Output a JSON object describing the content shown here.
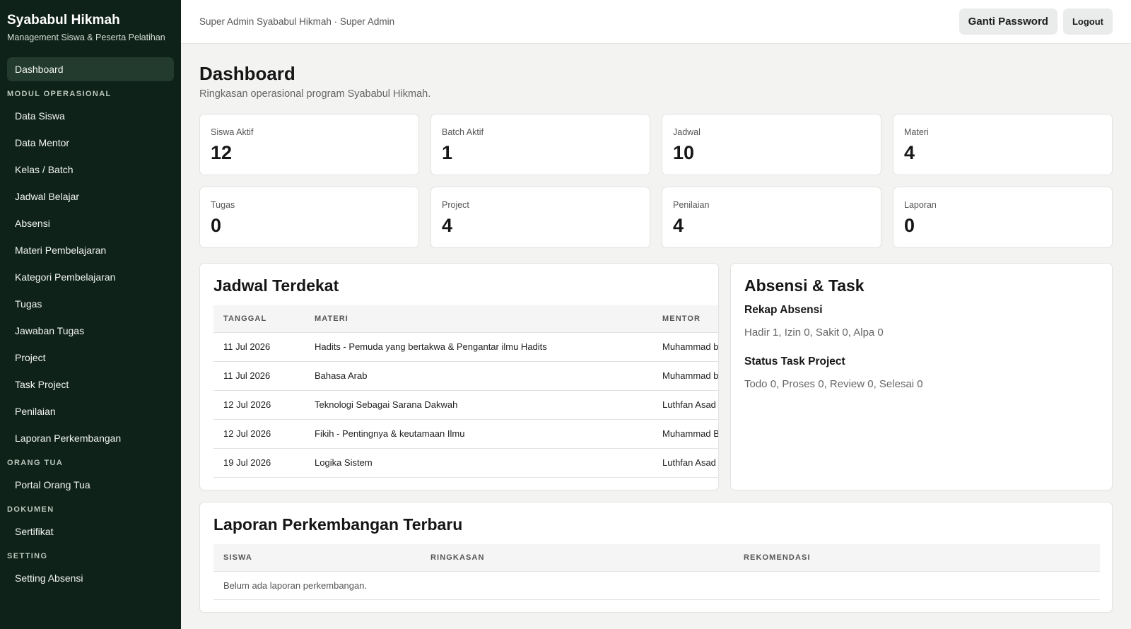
{
  "brand": {
    "title": "Syababul Hikmah",
    "subtitle": "Management Siswa & Peserta Pelatihan"
  },
  "sidebar": {
    "dashboard": "Dashboard",
    "sections": [
      {
        "title": "MODUL OPERASIONAL",
        "items": [
          "Data Siswa",
          "Data Mentor",
          "Kelas / Batch",
          "Jadwal Belajar",
          "Absensi",
          "Materi Pembelajaran",
          "Kategori Pembelajaran",
          "Tugas",
          "Jawaban Tugas",
          "Project",
          "Task Project",
          "Penilaian",
          "Laporan Perkembangan"
        ]
      },
      {
        "title": "ORANG TUA",
        "items": [
          "Portal Orang Tua"
        ]
      },
      {
        "title": "DOKUMEN",
        "items": [
          "Sertifikat"
        ]
      },
      {
        "title": "SETTING",
        "items": [
          "Setting Absensi"
        ]
      }
    ]
  },
  "header": {
    "user": "Super Admin Syababul Hikmah · Super Admin",
    "change_password": "Ganti Password",
    "logout": "Logout"
  },
  "page": {
    "title": "Dashboard",
    "subtitle": "Ringkasan operasional program Syababul Hikmah."
  },
  "stats": [
    {
      "label": "Siswa Aktif",
      "value": "12"
    },
    {
      "label": "Batch Aktif",
      "value": "1"
    },
    {
      "label": "Jadwal",
      "value": "10"
    },
    {
      "label": "Materi",
      "value": "4"
    },
    {
      "label": "Tugas",
      "value": "0"
    },
    {
      "label": "Project",
      "value": "4"
    },
    {
      "label": "Penilaian",
      "value": "4"
    },
    {
      "label": "Laporan",
      "value": "0"
    }
  ],
  "jadwal": {
    "title": "Jadwal Terdekat",
    "headers": [
      "TANGGAL",
      "MATERI",
      "MENTOR"
    ],
    "rows": [
      [
        "11 Jul 2026",
        "Hadits - Pemuda yang bertakwa & Pengantar ilmu Hadits",
        "Muhammad b"
      ],
      [
        "11 Jul 2026",
        "Bahasa Arab",
        "Muhammad b"
      ],
      [
        "12 Jul 2026",
        "Teknologi Sebagai Sarana Dakwah",
        "Luthfan Asad"
      ],
      [
        "12 Jul 2026",
        "Fikih - Pentingnya & keutamaan Ilmu",
        "Muhammad B"
      ],
      [
        "19 Jul 2026",
        "Logika Sistem",
        "Luthfan Asad"
      ]
    ]
  },
  "absensi": {
    "title": "Absensi & Task",
    "rekap_title": "Rekap Absensi",
    "rekap_text": "Hadir 1, Izin 0, Sakit 0, Alpa 0",
    "task_title": "Status Task Project",
    "task_text": "Todo 0, Proses 0, Review 0, Selesai 0"
  },
  "laporan": {
    "title": "Laporan Perkembangan Terbaru",
    "headers": [
      "SISWA",
      "RINGKASAN",
      "REKOMENDASI"
    ],
    "empty": "Belum ada laporan perkembangan."
  }
}
